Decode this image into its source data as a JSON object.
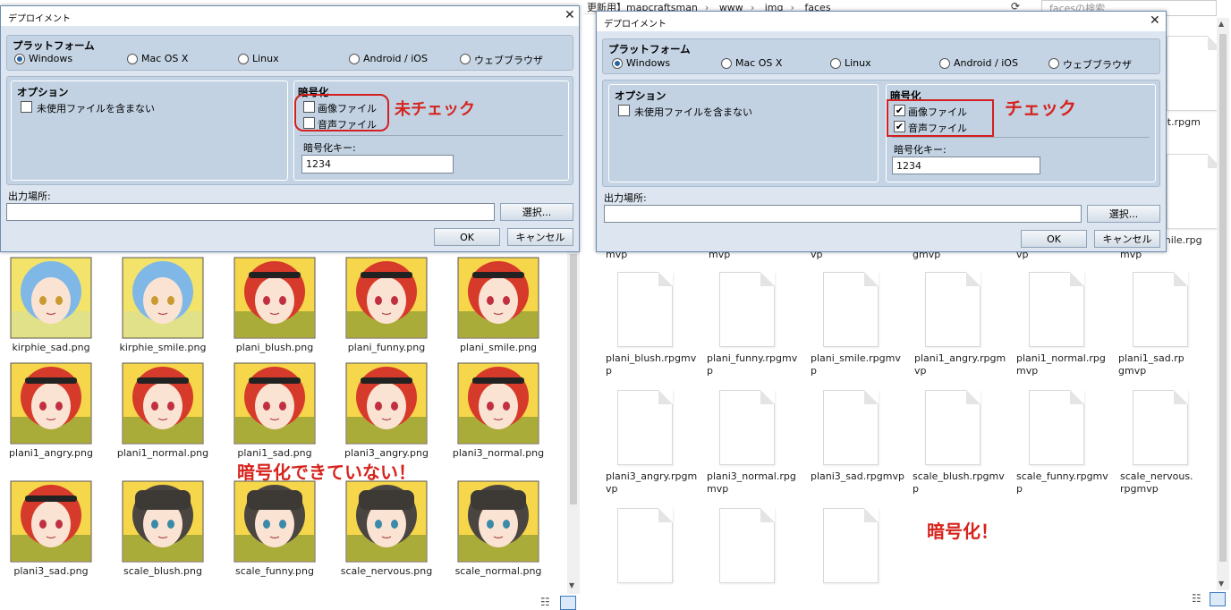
{
  "explorer": {
    "breadcrumb": [
      "更新用】mapcraftsman",
      "www",
      "img",
      "faces"
    ],
    "search_placeholder": "facesの検索",
    "top_labels": [
      "et.rpgm",
      "mile.rpg"
    ],
    "row_partial": [
      "mvp",
      "mvp",
      "vp",
      "gmvp",
      "vp",
      "mvp"
    ],
    "files_row1": [
      "plani_blush.rpgmvp",
      "plani_funny.rpgmvp",
      "plani_smile.rpgmvp",
      "plani1_angry.rpgmvp",
      "plani1_normal.rpgmvp",
      "plani1_sad.rpgmvp"
    ],
    "files_row2": [
      "plani3_angry.rpgmvp",
      "plani3_normal.rpgmvp",
      "plani3_sad.rpgmvp",
      "scale_blush.rpgmvp",
      "scale_funny.rpgmvp",
      "scale_nervous.rpgmvp"
    ],
    "annotation": "暗号化！"
  },
  "left_explorer": {
    "files": [
      [
        "kirphie_sad.png",
        "kirphie_smile.png",
        "plani_blush.png",
        "plani_funny.png",
        "plani_smile.png"
      ],
      [
        "plani1_angry.png",
        "plani1_normal.png",
        "plani1_sad.png",
        "plani3_angry.png",
        "plani3_normal.png"
      ],
      [
        "plani3_sad.png",
        "scale_blush.png",
        "scale_funny.png",
        "scale_nervous.png",
        "scale_normal.png"
      ]
    ],
    "annotation": "暗号化できていない！"
  },
  "dialog_left": {
    "title": "デプロイメント",
    "platform_label": "プラットフォーム",
    "platforms": [
      "Windows",
      "Mac OS X",
      "Linux",
      "Android / iOS",
      "ウェブブラウザ"
    ],
    "options_label": "オプション",
    "exclude_unused": "未使用ファイルを含まない",
    "encrypt_label": "暗号化",
    "image_files": "画像ファイル",
    "audio_files": "音声ファイル",
    "image_checked": false,
    "audio_checked": false,
    "key_label": "暗号化キー:",
    "key_value": "1234",
    "output_label": "出力場所:",
    "output_value": "",
    "browse": "選択...",
    "ok": "OK",
    "cancel": "キャンセル",
    "annotation": "未チェック"
  },
  "dialog_right": {
    "title": "デプロイメント",
    "platform_label": "プラットフォーム",
    "platforms": [
      "Windows",
      "Mac OS X",
      "Linux",
      "Android / iOS",
      "ウェブブラウザ"
    ],
    "options_label": "オプション",
    "exclude_unused": "未使用ファイルを含まない",
    "encrypt_label": "暗号化",
    "image_files": "画像ファイル",
    "audio_files": "音声ファイル",
    "image_checked": true,
    "audio_checked": true,
    "key_label": "暗号化キー:",
    "key_value": "1234",
    "output_label": "出力場所:",
    "output_value": "",
    "browse": "選択...",
    "ok": "OK",
    "cancel": "キャンセル",
    "annotation": "チェック"
  },
  "colors": {
    "annotation_red": "#d6231c",
    "dialog_bg": "#dde6f0",
    "group_bg": "#c2d2e3"
  }
}
